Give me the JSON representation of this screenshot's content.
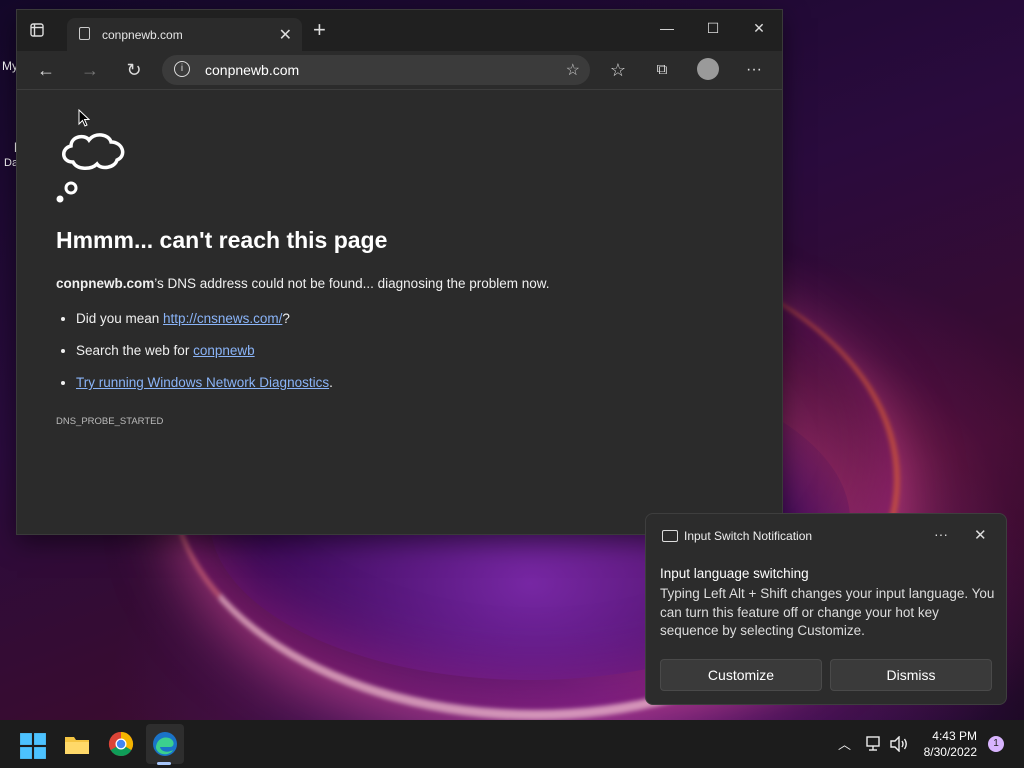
{
  "desktop": {
    "label_my": "My",
    "label_da": "Da",
    "label_i": "I"
  },
  "browser": {
    "tab_title": "conpnewb.com",
    "url": "conpnewb.com",
    "window_controls": {
      "minimize": "—",
      "maximize": "☐",
      "close": "✕"
    },
    "new_tab": "+",
    "tab_close": "✕"
  },
  "error_page": {
    "heading": "Hmmm... can't reach this page",
    "domain": "conpnewb.com",
    "desc_rest": "’s DNS address could not be found... diagnosing the problem now.",
    "suggestion1_prefix": "Did you mean ",
    "suggestion1_link": "http://cnsnews.com/",
    "suggestion1_suffix": "?",
    "suggestion2_prefix": "Search the web for ",
    "suggestion2_link": "conpnewb",
    "suggestion3_link": "Try running Windows Network Diagnostics",
    "suggestion3_suffix": ".",
    "error_code": "DNS_PROBE_STARTED"
  },
  "notification": {
    "title": "Input Switch Notification",
    "more": "···",
    "close": "✕",
    "heading": "Input language switching",
    "body": "Typing Left Alt + Shift changes your input language. You can turn this feature off or change your hot key sequence by selecting Customize.",
    "customize": "Customize",
    "dismiss": "Dismiss"
  },
  "taskbar": {
    "time": "4:43 PM",
    "date": "8/30/2022",
    "notification_count": "1"
  }
}
